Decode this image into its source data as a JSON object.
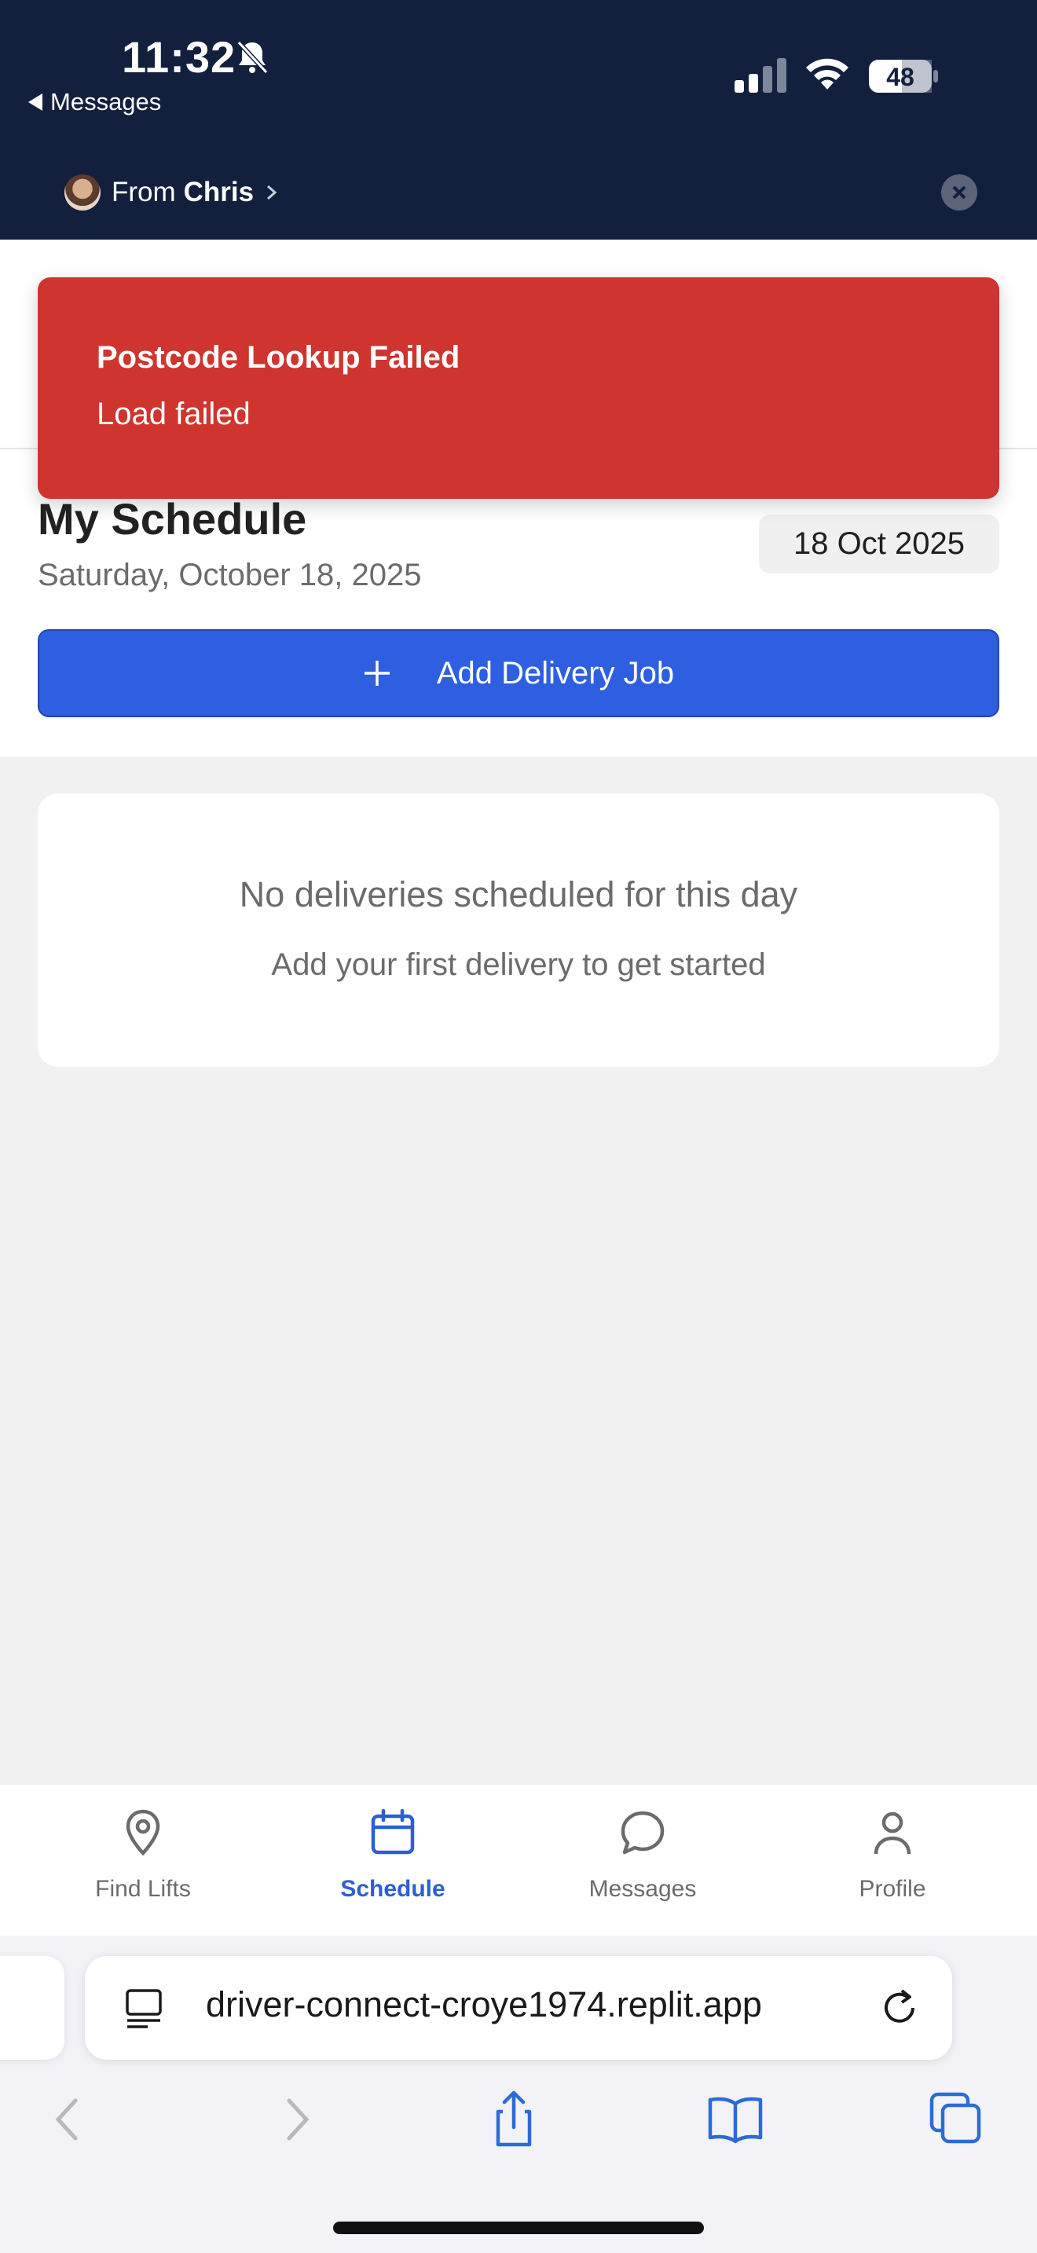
{
  "status": {
    "time": "11:32",
    "back_label": "Messages",
    "battery": "48"
  },
  "notification": {
    "from_prefix": "From",
    "from_name": "Chris"
  },
  "toast": {
    "title": "Postcode Lookup Failed",
    "message": "Load failed",
    "color": "#cf342f"
  },
  "header": {
    "title": "My Schedule",
    "date_long": "Saturday, October 18, 2025",
    "date_badge": "18 Oct 2025"
  },
  "actions": {
    "add_job_label": "Add Delivery Job",
    "accent": "#2d5fe0"
  },
  "empty_state": {
    "title": "No deliveries scheduled for this day",
    "subtitle": "Add your first delivery to get started"
  },
  "tabs": [
    {
      "label": "Find Lifts",
      "icon": "map-pin-icon",
      "active": false
    },
    {
      "label": "Schedule",
      "icon": "calendar-icon",
      "active": true
    },
    {
      "label": "Messages",
      "icon": "chat-bubble-icon",
      "active": false
    },
    {
      "label": "Profile",
      "icon": "user-icon",
      "active": false
    }
  ],
  "browser": {
    "url": "driver-connect-croye1974.replit.app"
  }
}
